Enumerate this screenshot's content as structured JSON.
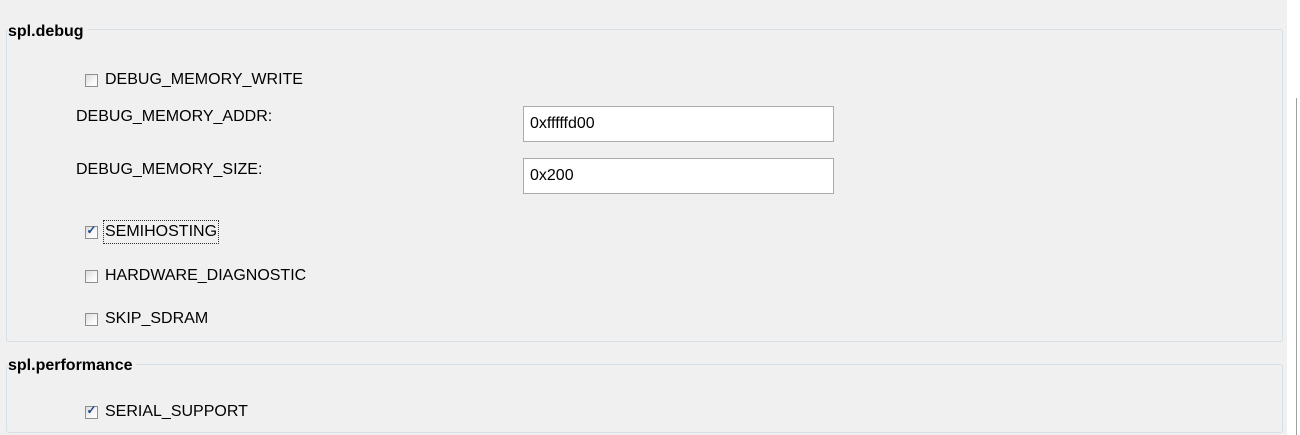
{
  "groups": {
    "debug": {
      "title": "spl.debug",
      "debug_memory_write": {
        "label": "DEBUG_MEMORY_WRITE",
        "checked": false
      },
      "debug_memory_addr": {
        "label": "DEBUG_MEMORY_ADDR:",
        "value": "0xfffffd00"
      },
      "debug_memory_size": {
        "label": "DEBUG_MEMORY_SIZE:",
        "value": "0x200"
      },
      "semihosting": {
        "label": "SEMIHOSTING",
        "checked": true
      },
      "hardware_diagnostic": {
        "label": "HARDWARE_DIAGNOSTIC",
        "checked": false
      },
      "skip_sdram": {
        "label": "SKIP_SDRAM",
        "checked": false
      }
    },
    "performance": {
      "title": "spl.performance",
      "serial_support": {
        "label": "SERIAL_SUPPORT",
        "checked": true
      }
    }
  },
  "checkmark_glyph": "✓",
  "colors": {
    "panel_bg": "#f0f0f0",
    "group_border": "#d5dfe5",
    "checkmark": "#21468c"
  }
}
